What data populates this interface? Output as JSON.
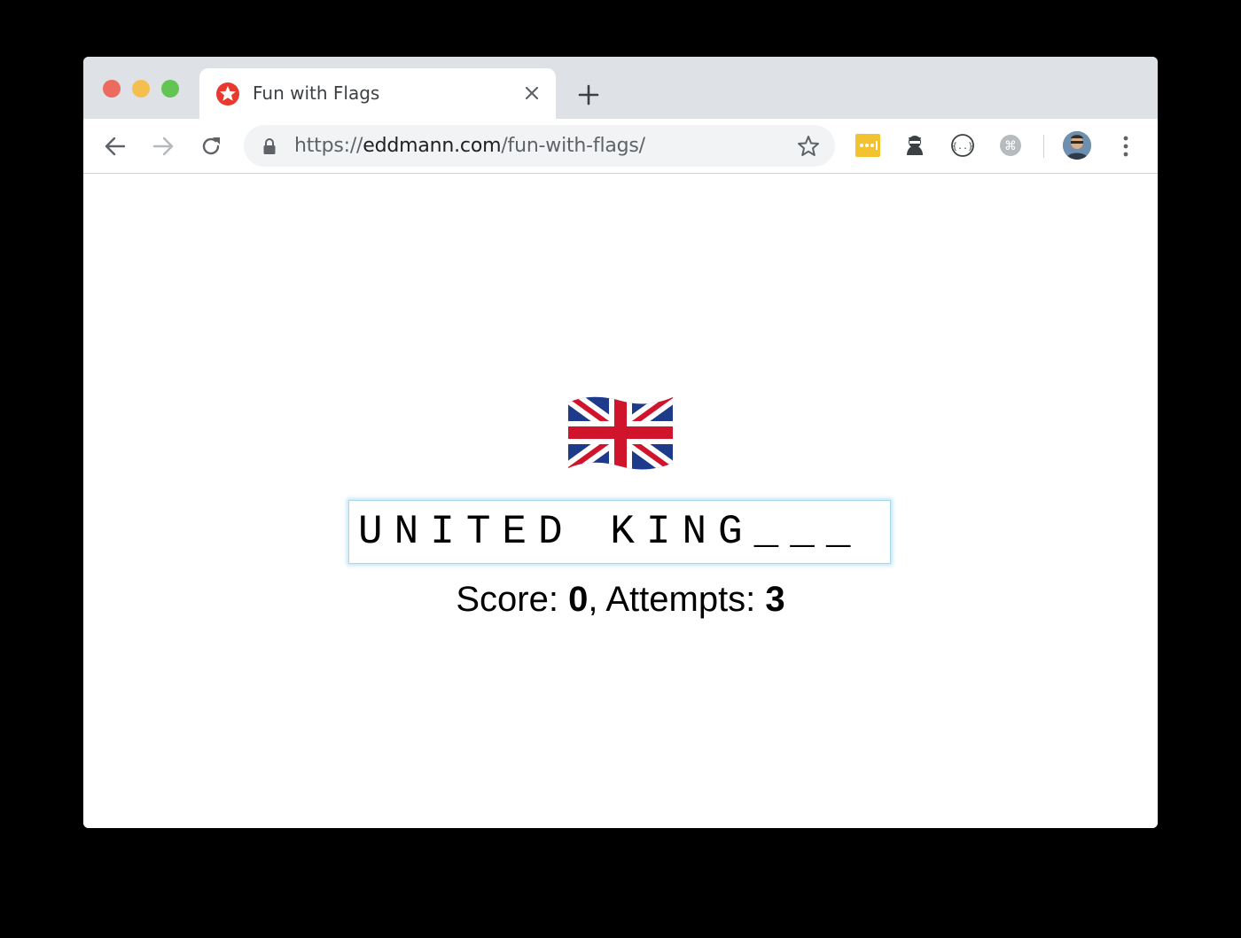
{
  "tab": {
    "title": "Fun with Flags"
  },
  "address_bar": {
    "scheme": "https://",
    "host": "eddmann.com",
    "path": "/fun-with-flags/"
  },
  "extensions": [
    {
      "icon": "ellipsis-extension-icon",
      "color": "#f2c230"
    },
    {
      "icon": "ninja-extension-icon"
    },
    {
      "icon": "json-extension-icon"
    },
    {
      "icon": "command-extension-icon"
    }
  ],
  "game": {
    "flag": "united-kingdom-flag",
    "guess": "UNITED KING___",
    "score_label": "Score: ",
    "score_value": "0",
    "separator": ", ",
    "attempts_label": "Attempts: ",
    "attempts_value": "3"
  },
  "colors": {
    "tab_bar": "#dee1e6",
    "omnibox": "#f1f3f4",
    "input_glow": "#a9d8ea"
  }
}
